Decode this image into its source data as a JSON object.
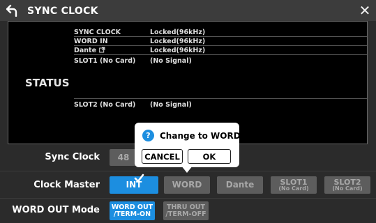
{
  "titlebar": {
    "title": "SYNC CLOCK"
  },
  "status": {
    "label": "STATUS",
    "rows": [
      {
        "name": "SYNC CLOCK",
        "value": "Locked(96kHz)"
      },
      {
        "name": "WORD IN",
        "value": "Locked(96kHz)"
      },
      {
        "name": "Dante",
        "value": "Locked(96kHz)"
      },
      {
        "name": "SLOT1 (No Card)",
        "value": "(No Signal)"
      },
      {
        "name": "SLOT2 (No Card)",
        "value": "(No Signal)"
      }
    ]
  },
  "sync_clock": {
    "label": "Sync Clock",
    "value": "48"
  },
  "clock_master": {
    "label": "Clock Master",
    "options": [
      {
        "label": "INT",
        "sub": "",
        "selected": true
      },
      {
        "label": "WORD",
        "sub": "",
        "selected": false
      },
      {
        "label": "Dante",
        "sub": "",
        "selected": false
      },
      {
        "label": "SLOT1",
        "sub": "(No Card)",
        "selected": false
      },
      {
        "label": "SLOT2",
        "sub": "(No Card)",
        "selected": false
      }
    ]
  },
  "word_out_mode": {
    "label": "WORD OUT Mode",
    "options": [
      {
        "line1": "WORD OUT",
        "line2": "/TERM-ON",
        "selected": true
      },
      {
        "line1": "THRU OUT",
        "line2": "/TERM-OFF",
        "selected": false
      }
    ]
  },
  "popup": {
    "title": "Change to WORD?",
    "cancel_label": "CANCEL",
    "ok_label": "OK"
  },
  "colors": {
    "accent": "#1c8ee0",
    "panel": "#2b2b2b",
    "button_gray": "#5d5d5d"
  },
  "icons": {
    "back": "back-arrow-icon",
    "close": "close-icon",
    "link": "external-link-icon",
    "question": "question-icon",
    "check": "checkmark-icon"
  }
}
